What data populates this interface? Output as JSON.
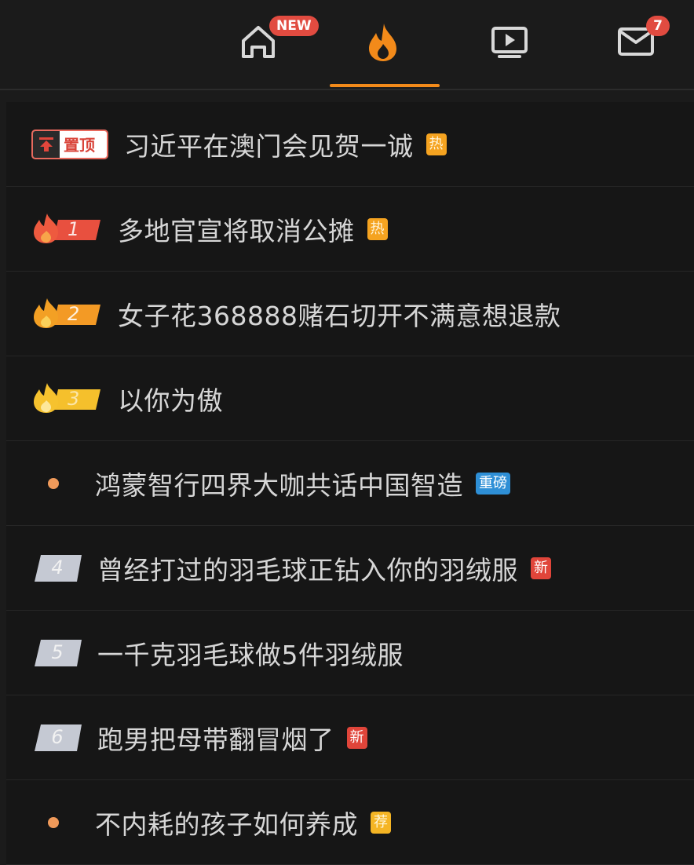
{
  "nav": {
    "new_badge": "NEW",
    "message_count": "7",
    "accent_color": "#f28a1a",
    "icons": [
      "home-icon",
      "flame-icon",
      "tv-play-icon",
      "mail-icon"
    ]
  },
  "pinned": {
    "label": "置顶",
    "title": "习近平在澳门会见贺一诚",
    "tag": "热"
  },
  "items": [
    {
      "rank": "1",
      "title": "多地官宣将取消公摊",
      "tag": "热"
    },
    {
      "rank": "2",
      "title": "女子花368888赌石切开不满意想退款",
      "tag": ""
    },
    {
      "rank": "3",
      "title": "以你为傲",
      "tag": ""
    },
    {
      "rank": "",
      "title": "鸿蒙智行四界大咖共话中国智造",
      "tag": "重磅"
    },
    {
      "rank": "4",
      "title": "曾经打过的羽毛球正钻入你的羽绒服",
      "tag": "新"
    },
    {
      "rank": "5",
      "title": "一千克羽毛球做5件羽绒服",
      "tag": ""
    },
    {
      "rank": "6",
      "title": "跑男把母带翻冒烟了",
      "tag": "新"
    },
    {
      "rank": "",
      "title": "不内耗的孩子如何养成",
      "tag": "荐"
    }
  ],
  "colors": {
    "rank1": "#e8503f",
    "rank2": "#f39a25",
    "rank3": "#f5c02c",
    "plain_rank": "#c5c9d3",
    "hot_tag": "#f5a320",
    "new_tag": "#e0453a",
    "big_tag": "#2e8fd6",
    "rec_tag": "#f5b524"
  }
}
